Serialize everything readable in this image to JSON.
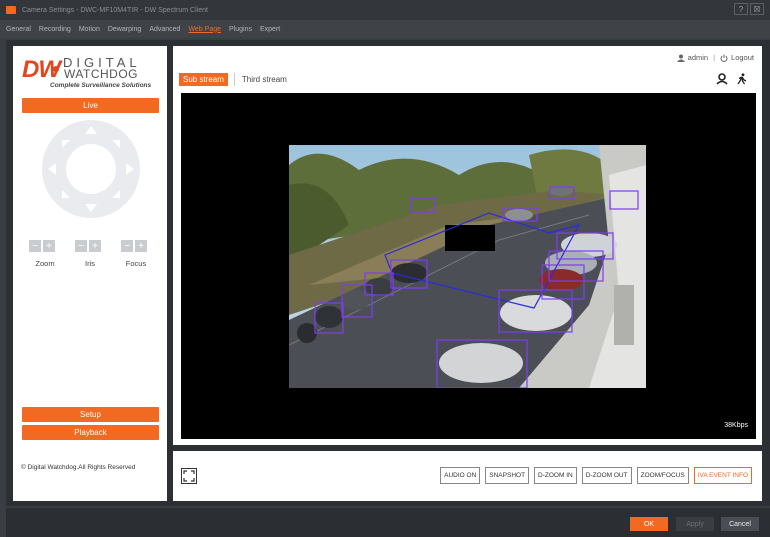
{
  "window": {
    "title": "Camera Settings - DWC-MF10M4TIR - DW Spectrum Client",
    "buttons": [
      "?",
      "☒"
    ]
  },
  "tabs": [
    {
      "label": "General"
    },
    {
      "label": "Recording"
    },
    {
      "label": "Motion"
    },
    {
      "label": "Dewarping"
    },
    {
      "label": "Advanced"
    },
    {
      "label": "Web Page",
      "active": true
    },
    {
      "label": "Plugins"
    },
    {
      "label": "Expert"
    }
  ],
  "logo": {
    "mark": "DW",
    "line1": "DIGITAL",
    "line2": "WATCHDOG",
    "tagline": "Complete Surveillance Solutions"
  },
  "sidebar": {
    "live_label": "Live",
    "controls": [
      {
        "label": "Zoom",
        "minus": "−",
        "plus": "+"
      },
      {
        "label": "Iris",
        "minus": "−",
        "plus": "+"
      },
      {
        "label": "Focus",
        "minus": "−",
        "plus": "+"
      }
    ],
    "setup_label": "Setup",
    "playback_label": "Playback",
    "copyright": "© Digital Watchdog.All Rights Reserved"
  },
  "header": {
    "user": "admin",
    "separator": "|",
    "logout": "Logout"
  },
  "streams": {
    "sub": "Sub stream",
    "third": "Third stream"
  },
  "video": {
    "bitrate": "38Kbps"
  },
  "actions": [
    "AUDIO ON",
    "SNAPSHOT",
    "D-ZOOM IN",
    "D-ZOOM OUT",
    "ZOOM/FOCUS",
    "IVA EVENT INFO"
  ],
  "footer": {
    "ok": "OK",
    "apply": "Apply",
    "cancel": "Cancel"
  },
  "colors": {
    "accent": "#f26a21",
    "detection_box": "#7d3df0"
  },
  "icons": {
    "user": "user-icon",
    "logout": "power-icon",
    "person_detect": "person-pin-icon",
    "walking": "walking-person-icon",
    "fullscreen": "fullscreen-icon"
  }
}
